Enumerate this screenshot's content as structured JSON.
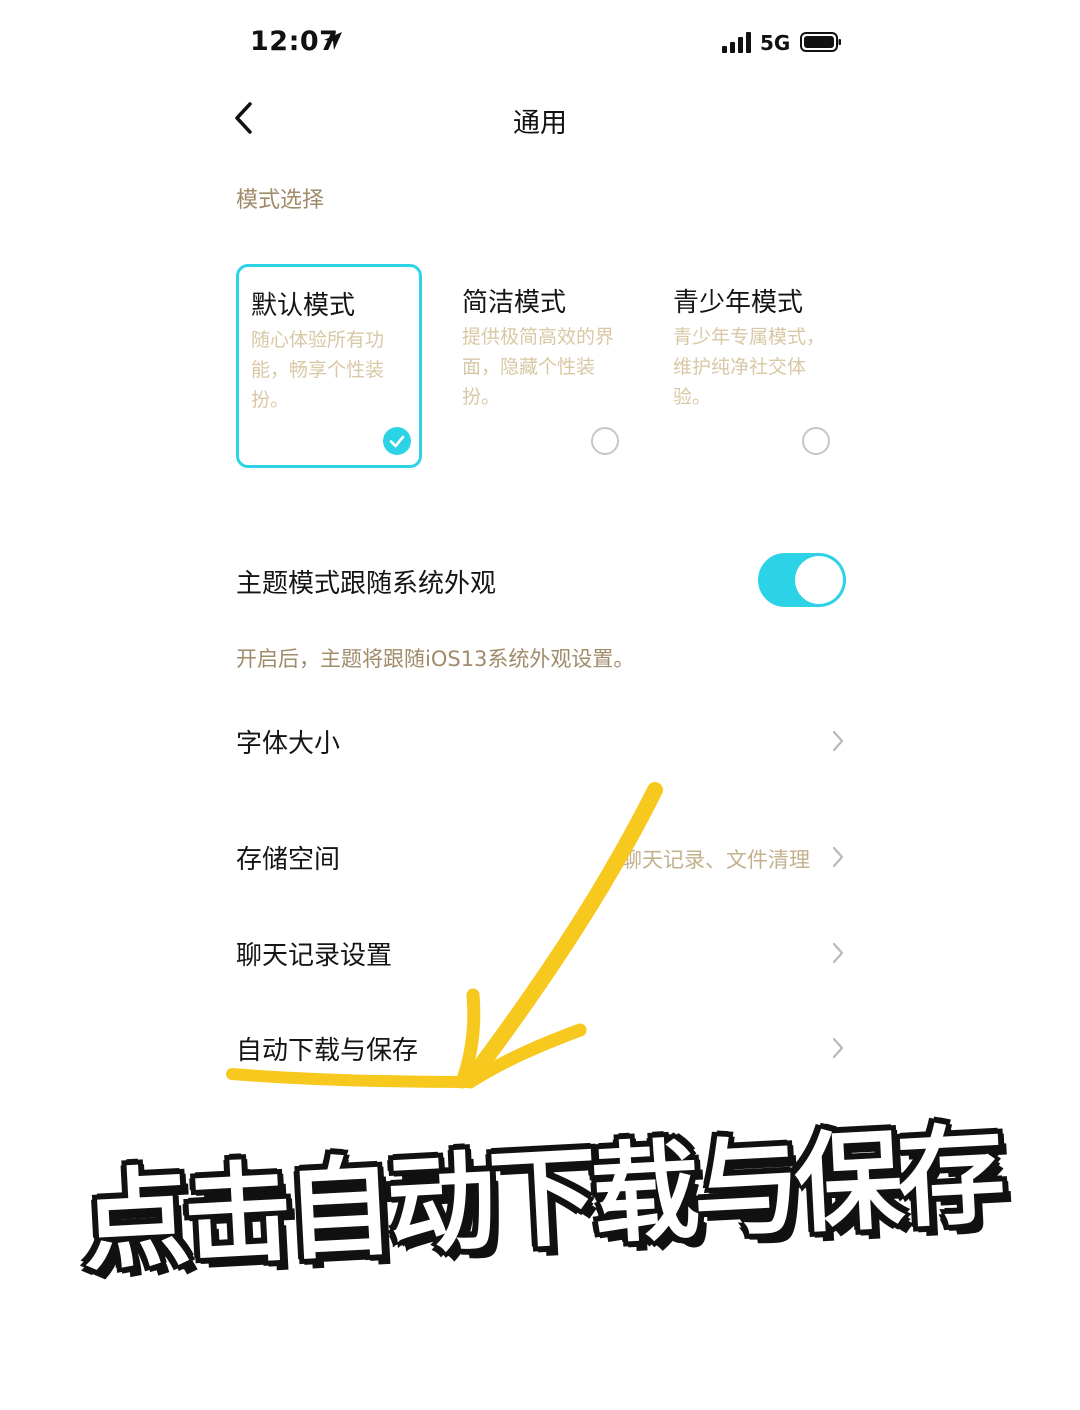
{
  "status_bar": {
    "time": "12:07",
    "network": "5G",
    "icons": [
      "location-arrow-icon",
      "signal-icon",
      "battery-icon"
    ]
  },
  "nav": {
    "title": "通用",
    "back_icon": "chevron-left-icon"
  },
  "mode_section": {
    "label": "模式选择",
    "cards": [
      {
        "title": "默认模式",
        "desc": "随心体验所有功能，畅享个性装扮。",
        "selected": true
      },
      {
        "title": "简洁模式",
        "desc": "提供极简高效的界面，隐藏个性装扮。",
        "selected": false
      },
      {
        "title": "青少年模式",
        "desc": "青少年专属模式，维护纯净社交体验。",
        "selected": false
      }
    ]
  },
  "theme_follow": {
    "label": "主题模式跟随系统外观",
    "enabled": true,
    "helper": "开启后，主题将跟随iOS13系统外观设置。"
  },
  "rows": [
    {
      "label": "字体大小",
      "detail": ""
    },
    {
      "label": "存储空间",
      "detail": "聊天记录、文件清理"
    },
    {
      "label": "聊天记录设置",
      "detail": ""
    },
    {
      "label": "自动下载与保存",
      "detail": ""
    }
  ],
  "annotation": {
    "caption": "点击自动下载与保存",
    "color": "#f7c81e"
  },
  "colors": {
    "accent": "#2cd3e7",
    "muted_text": "#a08b6a",
    "light_text": "#d9c8a6"
  }
}
